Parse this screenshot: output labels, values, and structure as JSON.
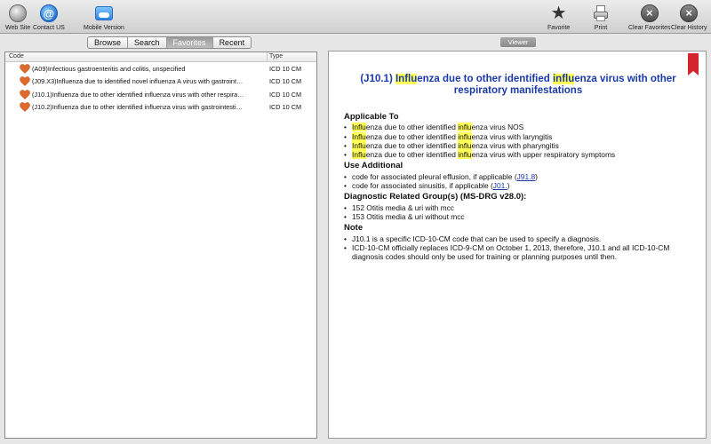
{
  "toolbar": {
    "website_label": "Web Site",
    "contact_label": "Contact US",
    "mobile_label": "Mobile Version",
    "favorite_label": "Favorite",
    "print_label": "Print",
    "clear_favorites_label": "Clear Favorites",
    "clear_history_label": "Clear History"
  },
  "tabs": [
    "Browse",
    "Search",
    "Favorites",
    "Recent"
  ],
  "active_tab": "Favorites",
  "list": {
    "columns": {
      "code": "Code",
      "type": "Type"
    },
    "rows": [
      {
        "code": "(A09)Infectious gastroenteritis and colitis, unspecified",
        "type": "ICD 10 CM"
      },
      {
        "code": "(J09.X3)Influenza due to identified novel influenza A virus with gastroint…",
        "type": "ICD 10 CM"
      },
      {
        "code": "(J10.1)Influenza due to other identified influenza virus with other respira…",
        "type": "ICD 10 CM"
      },
      {
        "code": "(J10.2)Influenza due to other identified influenza virus with gastrointesti…",
        "type": "ICD 10 CM"
      }
    ]
  },
  "viewer": {
    "label": "Viewer",
    "title_parts": {
      "code": "(J10.1)",
      "infl1": "Influ",
      "mid": "enza due to other identified",
      "infl2": "influ",
      "rest": "enza virus with other respiratory manifestations"
    },
    "applicable_to": {
      "heading": "Applicable To",
      "items": [
        {
          "a": "Influ",
          "b": "enza due to other identified",
          "c": "influ",
          "d": "enza virus NOS"
        },
        {
          "a": "Influ",
          "b": "enza due to other identified",
          "c": "influ",
          "d": "enza virus with laryngitis"
        },
        {
          "a": "Influ",
          "b": "enza due to other identified",
          "c": "influ",
          "d": "enza virus with pharyngitis"
        },
        {
          "a": "Influ",
          "b": "enza due to other identified",
          "c": "influ",
          "d": "enza virus with upper respiratory symptoms"
        }
      ]
    },
    "use_additional": {
      "heading": "Use Additional",
      "items": [
        {
          "text": "code for associated pleural effusion, if applicable (",
          "link": "J91.8",
          "end": ")"
        },
        {
          "text": "code for associated sinusitis, if applicable (",
          "link": "J01.",
          "end": ")"
        }
      ]
    },
    "drg": {
      "heading": "Diagnostic Related Group(s) (MS-DRG v28.0):",
      "items": [
        "152 Otitis media & uri with mcc",
        "153 Otitis media & uri without mcc"
      ]
    },
    "note": {
      "heading": "Note",
      "items": [
        "J10.1 is a specific ICD-10-CM code that can be used to specify a diagnosis.",
        "ICD-10-CM officially replaces ICD-9-CM on October 1, 2013, therefore, J10.1 and all ICD-10-CM diagnosis codes should only be used for training or planning purposes until then."
      ]
    }
  },
  "colors": {
    "title": "#1a3aa8",
    "highlight": "#ffff55",
    "heart": "#e06a2a",
    "bookmark": "#d4242d"
  }
}
